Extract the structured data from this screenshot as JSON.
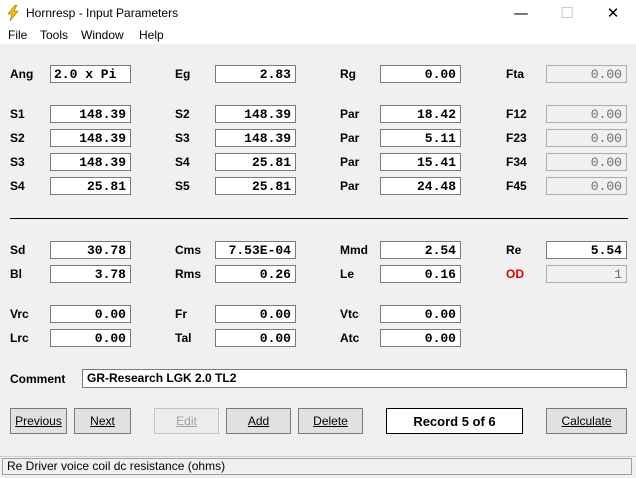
{
  "window": {
    "title": "Hornresp - Input Parameters",
    "controls": {
      "minimize": "—",
      "maximize": "☐",
      "close": "✕"
    }
  },
  "menu": [
    "File",
    "Tools",
    "Window",
    "Help"
  ],
  "params": {
    "ang": {
      "label": "Ang",
      "value": "2.0 x Pi"
    },
    "eg": {
      "label": "Eg",
      "value": "2.83"
    },
    "rg": {
      "label": "Rg",
      "value": "0.00"
    },
    "fta": {
      "label": "Fta",
      "value": "0.00"
    },
    "c1s1": {
      "label": "S1",
      "value": "148.39"
    },
    "c1s2": {
      "label": "S2",
      "value": "148.39"
    },
    "c1s3": {
      "label": "S3",
      "value": "148.39"
    },
    "c1s4": {
      "label": "S4",
      "value": "25.81"
    },
    "c2s2": {
      "label": "S2",
      "value": "148.39"
    },
    "c2s3": {
      "label": "S3",
      "value": "148.39"
    },
    "c2s4": {
      "label": "S4",
      "value": "25.81"
    },
    "c2s5": {
      "label": "S5",
      "value": "25.81"
    },
    "par1": {
      "label": "Par",
      "value": "18.42"
    },
    "par2": {
      "label": "Par",
      "value": "5.11"
    },
    "par3": {
      "label": "Par",
      "value": "15.41"
    },
    "par4": {
      "label": "Par",
      "value": "24.48"
    },
    "f12": {
      "label": "F12",
      "value": "0.00"
    },
    "f23": {
      "label": "F23",
      "value": "0.00"
    },
    "f34": {
      "label": "F34",
      "value": "0.00"
    },
    "f45": {
      "label": "F45",
      "value": "0.00"
    },
    "sd": {
      "label": "Sd",
      "value": "30.78"
    },
    "bl": {
      "label": "Bl",
      "value": "3.78"
    },
    "cms": {
      "label": "Cms",
      "value": "7.53E-04"
    },
    "rms": {
      "label": "Rms",
      "value": "0.26"
    },
    "mmd": {
      "label": "Mmd",
      "value": "2.54"
    },
    "le": {
      "label": "Le",
      "value": "0.16"
    },
    "re": {
      "label": "Re",
      "value": "5.54"
    },
    "od": {
      "label": "OD",
      "value": "1"
    },
    "vrc": {
      "label": "Vrc",
      "value": "0.00"
    },
    "lrc": {
      "label": "Lrc",
      "value": "0.00"
    },
    "fr": {
      "label": "Fr",
      "value": "0.00"
    },
    "tal": {
      "label": "Tal",
      "value": "0.00"
    },
    "vtc": {
      "label": "Vtc",
      "value": "0.00"
    },
    "atc": {
      "label": "Atc",
      "value": "0.00"
    }
  },
  "comment": {
    "label": "Comment",
    "value": "GR-Research LGK 2.0 TL2"
  },
  "buttons": {
    "previous": "Previous",
    "next": "Next",
    "edit": "Edit",
    "add": "Add",
    "delete": "Delete",
    "calculate": "Calculate"
  },
  "record": "Record 5 of 6",
  "status": "Re   Driver voice coil dc resistance  (ohms)",
  "colors": {
    "od_label": "#e00000",
    "icon": "#f2c200"
  }
}
